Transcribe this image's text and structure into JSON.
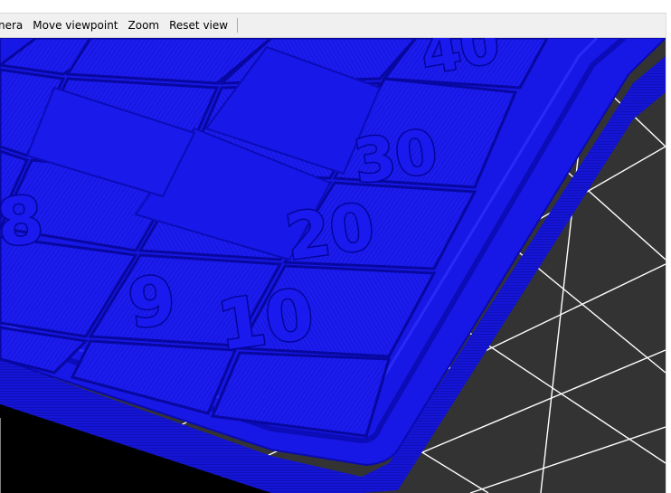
{
  "toolbar": {
    "items": [
      {
        "label": "nera"
      },
      {
        "label": "Move viewpoint"
      },
      {
        "label": "Zoom"
      },
      {
        "label": "Reset view"
      }
    ]
  },
  "viewport": {
    "tray_labels": [
      "40",
      "30",
      "20",
      "10",
      "8",
      "9"
    ]
  },
  "colors": {
    "model": "#1a1aee",
    "model_dark": "#0a0ab0",
    "bed": "#333333",
    "grid_line": "#ffffff",
    "background": "#000000",
    "toolbar_bg": "#f0f0f0"
  }
}
